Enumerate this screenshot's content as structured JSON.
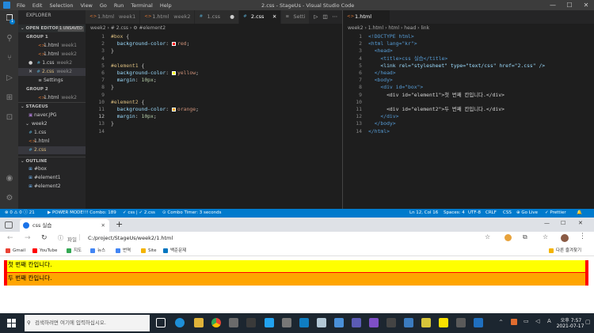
{
  "vscode": {
    "menu": [
      "File",
      "Edit",
      "Selection",
      "View",
      "Go",
      "Run",
      "Terminal",
      "Help"
    ],
    "window_title": "2.css - StageUs - Visual Studio Code",
    "window_controls": [
      "—",
      "☐",
      "✕"
    ]
  },
  "sidebar": {
    "explorer_title": "EXPLORER",
    "open_editors": "OPEN EDITORS",
    "unsaved_badge": "1 UNSAVED",
    "group1": "GROUP 1",
    "group2": "GROUP 2",
    "g1_items": [
      {
        "name": "1.html",
        "sub": "week1",
        "type": "html"
      },
      {
        "name": "1.html",
        "sub": "week2",
        "type": "html"
      },
      {
        "name": "1.css",
        "sub": "week2",
        "type": "css"
      },
      {
        "name": "2.css",
        "sub": "week2",
        "type": "css"
      },
      {
        "name": "Settings",
        "sub": "",
        "type": "settings"
      }
    ],
    "g2_items": [
      {
        "name": "1.html",
        "sub": "week2",
        "type": "html"
      }
    ],
    "stageus": "STAGEUS",
    "tree": [
      {
        "name": "naver.JPG",
        "type": "img"
      },
      {
        "name": "week2",
        "type": "folder"
      },
      {
        "name": "1.css",
        "type": "css"
      },
      {
        "name": "1.html",
        "type": "html"
      },
      {
        "name": "2.css",
        "type": "css"
      }
    ],
    "outline": "OUTLINE",
    "outline_items": [
      "#box",
      "#element1",
      "#element2"
    ]
  },
  "editor1": {
    "tabs": [
      {
        "name": "1.html",
        "sub": "week1",
        "type": "html"
      },
      {
        "name": "1.html",
        "sub": "week2",
        "type": "html"
      },
      {
        "name": "1.css",
        "sub": "",
        "type": "css"
      },
      {
        "name": "2.css",
        "sub": "",
        "type": "css"
      },
      {
        "name": "Setti",
        "sub": "",
        "type": "settings"
      }
    ],
    "breadcrumb": "week2 › # 2.css › ⚙ #element2",
    "lines": [
      {
        "n": "1",
        "t": "#box {"
      },
      {
        "n": "2",
        "t": "  background-color: red;"
      },
      {
        "n": "3",
        "t": "}"
      },
      {
        "n": "4",
        "t": ""
      },
      {
        "n": "5",
        "t": "#element1 {"
      },
      {
        "n": "6",
        "t": "  background-color: yellow;"
      },
      {
        "n": "7",
        "t": "  margin: 10px;"
      },
      {
        "n": "8",
        "t": "}"
      },
      {
        "n": "9",
        "t": ""
      },
      {
        "n": "10",
        "t": "#element2 {"
      },
      {
        "n": "11",
        "t": "  background-color: orange;"
      },
      {
        "n": "12",
        "t": "  margin: 10px;"
      },
      {
        "n": "13",
        "t": "}"
      },
      {
        "n": "14",
        "t": ""
      }
    ]
  },
  "editor2": {
    "tab": "1.html",
    "breadcrumb": "week2 › 1.html › html › head › link",
    "lines": [
      {
        "n": "1",
        "t": "<!DOCTYPE html>"
      },
      {
        "n": "2",
        "t": "<html lang=\"kr\">"
      },
      {
        "n": "3",
        "t": "  <head>"
      },
      {
        "n": "4",
        "t": "    <title>css 실습</title>"
      },
      {
        "n": "5",
        "t": "    <link rel=\"stylesheet\" type=\"text/css\" href=\"2.css\" />"
      },
      {
        "n": "6",
        "t": "  </head>"
      },
      {
        "n": "7",
        "t": "  <body>"
      },
      {
        "n": "8",
        "t": "    <div id=\"box\">"
      },
      {
        "n": "9",
        "t": "      <div id=\"element1\">첫 번째 칸입니다.</div>"
      },
      {
        "n": "10",
        "t": ""
      },
      {
        "n": "11",
        "t": "      <div id=\"element2\">두 번째 칸입니다.</div>"
      },
      {
        "n": "12",
        "t": "    </div>"
      },
      {
        "n": "13",
        "t": "  </body>"
      },
      {
        "n": "14",
        "t": "</html>"
      }
    ]
  },
  "statusbar": {
    "errors": "⊗ 0 ⚠ 0 ⓘ 21",
    "mode": "▶ POWER MODE!!! Combo: 189",
    "file1": "✓ css | ✓ 2.css",
    "timer": "⊙ Combo Timer: 3 seconds",
    "position": "Ln 12, Col 16",
    "spaces": "Spaces: 4",
    "encoding": "UTF-8",
    "eol": "CRLF",
    "lang": "CSS",
    "golive": "⊕ Go Live",
    "prettier": "✓ Prettier"
  },
  "browser": {
    "tab_title": "css 실습",
    "address_prefix": "파일",
    "address": "C:/project/StageUs/week2/1.html",
    "bookmarks": [
      "Gmail",
      "YouTube",
      "지도",
      "뉴스",
      "번역",
      "Site",
      "백준문제"
    ],
    "other_bookmarks": "다른 즐겨찾기",
    "element1_text": "첫 번째 칸입니다.",
    "element2_text": "두 번째 칸입니다."
  },
  "taskbar": {
    "search_placeholder": "검색하려면 여기에 입력하십시오.",
    "time": "오후 7:57",
    "date": "2021-07-17"
  },
  "colors": {
    "vscode_blue": "#007acc",
    "red": "#ff0000",
    "yellow": "#ffff00",
    "orange": "#ffa500"
  }
}
